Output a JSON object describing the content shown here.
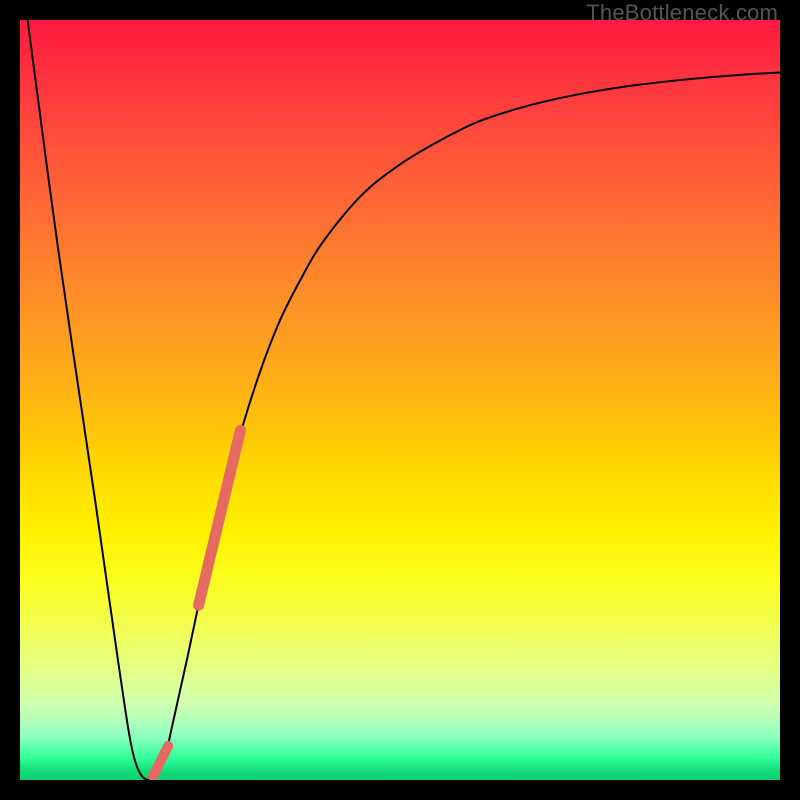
{
  "watermark": "TheBottleneck.com",
  "chart_data": {
    "type": "line",
    "title": "",
    "xlabel": "",
    "ylabel": "",
    "xlim": [
      0,
      100
    ],
    "ylim": [
      0,
      100
    ],
    "grid": false,
    "legend": false,
    "series": [
      {
        "name": "curve",
        "type": "line",
        "x": [
          1,
          5,
          10,
          13,
          15,
          17,
          19,
          20,
          22,
          25,
          28,
          31,
          34,
          37,
          40,
          45,
          50,
          55,
          60,
          65,
          70,
          75,
          80,
          85,
          90,
          95,
          100
        ],
        "y": [
          100,
          70,
          36,
          15,
          3,
          0,
          3,
          7,
          16,
          30,
          42,
          52,
          60,
          66,
          71,
          77,
          81,
          84,
          86.5,
          88.2,
          89.5,
          90.5,
          91.3,
          91.9,
          92.4,
          92.8,
          93.1
        ]
      },
      {
        "name": "highlight-upper",
        "type": "line",
        "x": [
          23.5,
          29.0
        ],
        "y": [
          23,
          46
        ]
      },
      {
        "name": "highlight-lower",
        "type": "line",
        "x": [
          17.5,
          19.5
        ],
        "y": [
          0.5,
          4.5
        ]
      }
    ],
    "colors": {
      "curve": "#000000",
      "highlight": "#e46a62"
    }
  }
}
